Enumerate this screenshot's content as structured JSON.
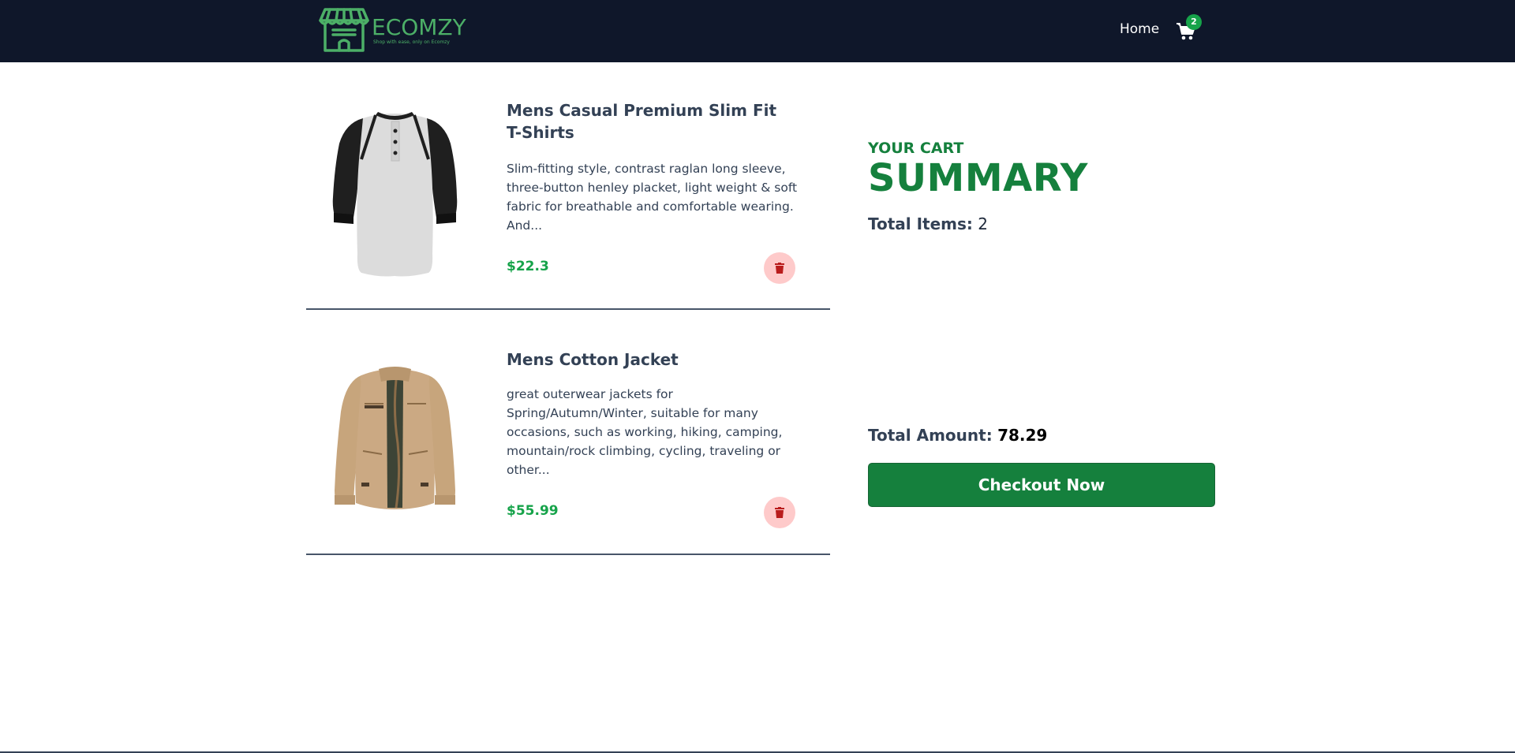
{
  "navbar": {
    "logo_text": "ECOMZY",
    "logo_tagline": "Shop with ease, only on Ecomzy",
    "home_label": "Home",
    "cart_count": "2"
  },
  "cart": {
    "items": [
      {
        "title": "Mens Casual Premium Slim Fit T-Shirts",
        "description": "Slim-fitting style, contrast raglan long sleeve, three-button henley placket, light weight & soft fabric for breathable and comfortable wearing. And...",
        "price": "$22.3"
      },
      {
        "title": "Mens Cotton Jacket",
        "description": "great outerwear jackets for Spring/Autumn/Winter, suitable for many occasions, such as working, hiking, camping, mountain/rock climbing, cycling, traveling or other...",
        "price": "$55.99"
      }
    ]
  },
  "summary": {
    "kicker": "YOUR CART",
    "title": "SUMMARY",
    "total_items_label": "Total Items:",
    "total_items_value": "2",
    "total_amount_label": "Total Amount:",
    "total_amount_value": "78.29",
    "checkout_label": "Checkout Now"
  },
  "colors": {
    "navbar_bg": "#0f172a",
    "brand_green": "#15803d",
    "price_green": "#16a34a",
    "delete_bg": "#fecaca",
    "delete_icon": "#b91c1c"
  },
  "icons": {
    "logo": "storefront-icon",
    "cart": "shopping-cart-icon",
    "delete": "trash-icon"
  }
}
